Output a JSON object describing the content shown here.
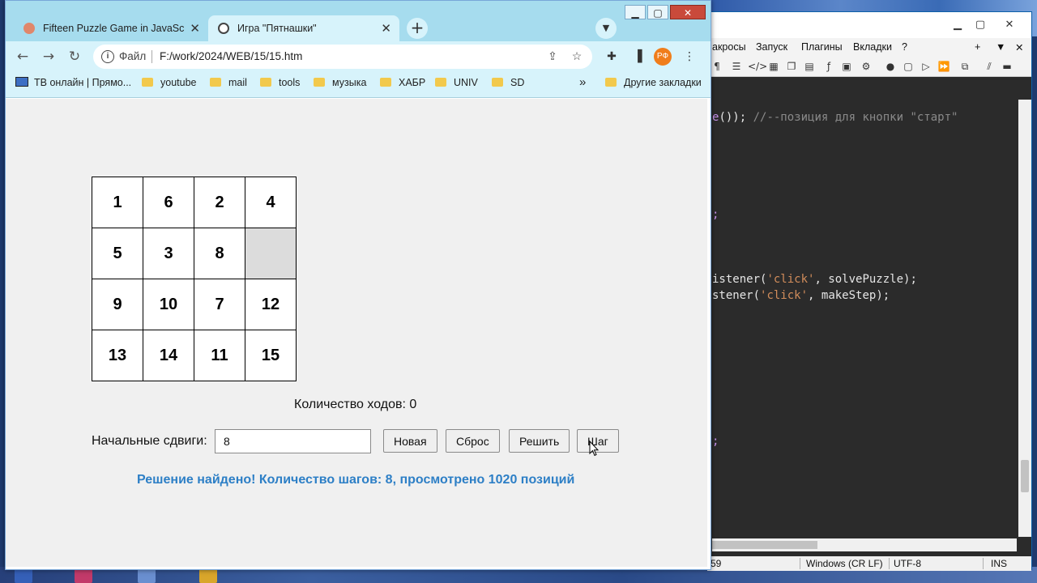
{
  "browser": {
    "tabs": [
      {
        "title": "Fifteen Puzzle Game in JavaScript",
        "active": false
      },
      {
        "title": "Игра \"Пятнашки\"",
        "active": true
      }
    ],
    "address": {
      "scheme": "Файл",
      "url": "F:/work/2024/WEB/15/15.htm"
    },
    "profile_initials": "РФ",
    "bookmarks": [
      {
        "label": "ТВ онлайн | Прямо...",
        "icon": "tv-icon"
      },
      {
        "label": "youtube",
        "icon": "folder-icon"
      },
      {
        "label": "mail",
        "icon": "folder-icon"
      },
      {
        "label": "tools",
        "icon": "folder-icon"
      },
      {
        "label": "музыка",
        "icon": "folder-icon"
      },
      {
        "label": "ХАБР",
        "icon": "folder-icon"
      },
      {
        "label": "UNIV",
        "icon": "folder-icon"
      },
      {
        "label": "SD",
        "icon": "folder-icon"
      }
    ],
    "bookmarks_overflow": "»",
    "other_bookmarks": "Другие закладки"
  },
  "game": {
    "tiles": [
      "1",
      "6",
      "2",
      "4",
      "5",
      "3",
      "8",
      "",
      "9",
      "10",
      "7",
      "12",
      "13",
      "14",
      "11",
      "15"
    ],
    "moves_text": "Количество ходов: 0",
    "shifts_label": "Начальные сдвиги:",
    "shifts_value": "8",
    "buttons": {
      "new": "Новая",
      "reset": "Сброс",
      "solve": "Решить",
      "step": "Шаг"
    },
    "result_text": "Решение найдено! Количество шагов: 8, просмотрено 1020 позиций",
    "result_color": "#2d7fc6"
  },
  "editor": {
    "menu": [
      "акросы",
      "Запуск",
      "Плагины",
      "Вкладки",
      "?"
    ],
    "code_lines": [
      {
        "parts": [
          [
            "punc",
            "e"
          ],
          [
            "plain",
            "()); "
          ],
          [
            "comment",
            "//--позиция для кнопки \"старт\""
          ]
        ]
      },
      {
        "parts": [
          [
            "punc",
            ";"
          ]
        ]
      },
      {
        "parts": [
          [
            "plain",
            "istener("
          ],
          [
            "string",
            "'click'"
          ],
          [
            "plain",
            ", solvePuzzle);"
          ]
        ]
      },
      {
        "parts": [
          [
            "plain",
            "stener("
          ],
          [
            "string",
            "'click'"
          ],
          [
            "plain",
            ", makeStep);"
          ]
        ]
      },
      {
        "parts": [
          [
            "punc",
            ";"
          ]
        ]
      }
    ],
    "status": {
      "pos": "59",
      "eol": "Windows (CR LF)",
      "encoding": "UTF-8",
      "mode": "INS"
    }
  }
}
